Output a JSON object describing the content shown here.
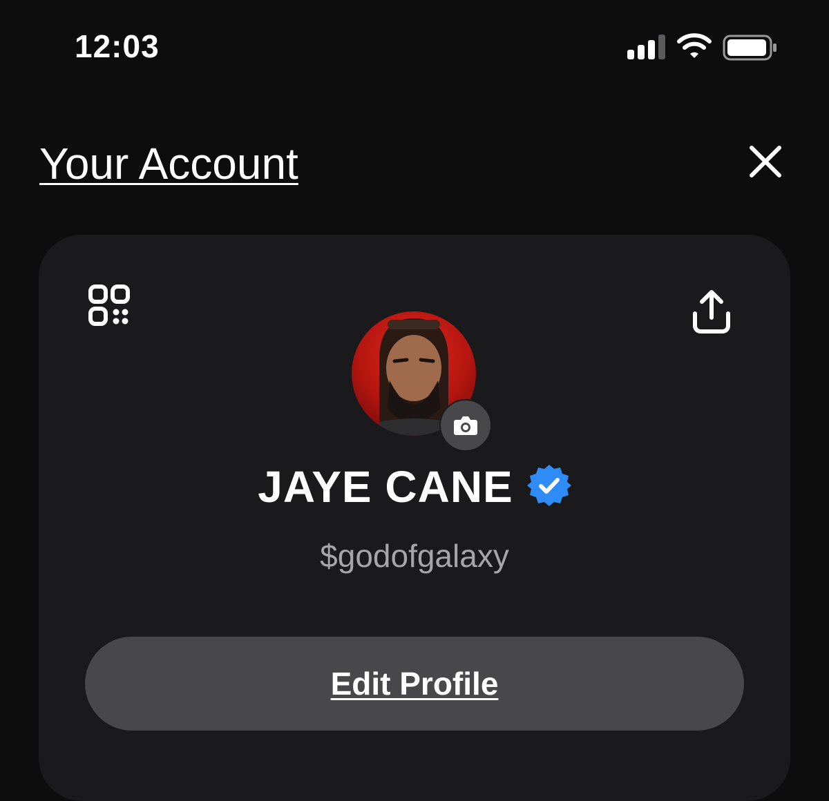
{
  "status_bar": {
    "time": "12:03",
    "signal_icon": "cellular-signal-icon",
    "wifi_icon": "wifi-icon",
    "battery_icon": "battery-icon"
  },
  "header": {
    "title": "Your Account",
    "close_icon": "close-icon"
  },
  "profile": {
    "name": "JAYE CANE",
    "cashtag": "$godofgalaxy",
    "verified_icon": "verified-badge-icon",
    "avatar": "profile-photo",
    "camera_icon": "camera-icon",
    "qr_icon": "qr-code-icon",
    "share_icon": "share-icon",
    "edit_label": "Edit Profile"
  },
  "colors": {
    "background": "#0d0d0e",
    "card": "#1a1a1c",
    "button": "#48484a",
    "verified": "#2f8bf5",
    "secondary_text": "#a6a6a8"
  }
}
